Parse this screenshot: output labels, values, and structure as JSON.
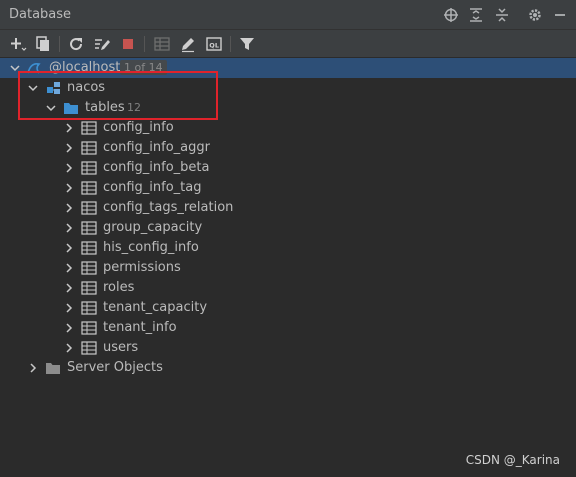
{
  "panel": {
    "title": "Database"
  },
  "datasource": {
    "name": "@localhost",
    "badge": "1 of 14"
  },
  "schema": {
    "name": "nacos"
  },
  "tables_folder": {
    "label": "tables",
    "count": "12"
  },
  "tables": [
    "config_info",
    "config_info_aggr",
    "config_info_beta",
    "config_info_tag",
    "config_tags_relation",
    "group_capacity",
    "his_config_info",
    "permissions",
    "roles",
    "tenant_capacity",
    "tenant_info",
    "users"
  ],
  "server_objects": {
    "label": "Server Objects"
  },
  "watermark": "CSDN @_Karina",
  "icons": {
    "titlebar": [
      "crosshair-icon",
      "expand-all-icon",
      "collapse-all-icon",
      "gear-icon",
      "minimize-icon"
    ],
    "toolbar": [
      "add-icon",
      "duplicate-icon",
      "refresh-icon",
      "edit-properties-icon",
      "stop-icon",
      "table-icon",
      "edit-icon",
      "console-icon",
      "filter-icon"
    ]
  },
  "colors": {
    "highlight": "#e0232b",
    "selection": "#2d4f77",
    "folder": "#3d8fd1",
    "stop": "#c75450"
  }
}
